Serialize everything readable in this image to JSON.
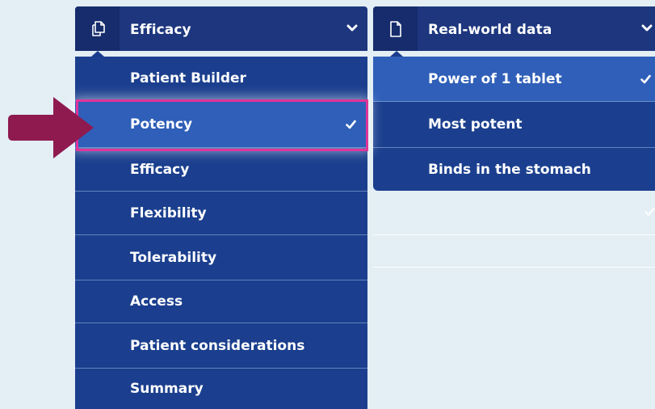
{
  "left_menu": {
    "header_label": "Efficacy",
    "icon": "copy-pages-icon",
    "items": [
      {
        "label": "Patient Builder",
        "selected": false
      },
      {
        "label": "Potency",
        "selected": true
      },
      {
        "label": "Efficacy",
        "selected": false
      },
      {
        "label": "Flexibility",
        "selected": false
      },
      {
        "label": "Tolerability",
        "selected": false
      },
      {
        "label": "Access",
        "selected": false
      },
      {
        "label": "Patient considerations",
        "selected": false
      },
      {
        "label": "Summary",
        "selected": false
      }
    ]
  },
  "right_menu": {
    "header_label": "Real-world data",
    "icon": "document-icon",
    "items": [
      {
        "label": "Power of 1 tablet",
        "selected": true
      },
      {
        "label": "Most potent",
        "selected": false
      },
      {
        "label": "Binds in the stomach",
        "selected": false
      }
    ]
  },
  "annotation": {
    "arrow_color": "#8f1a4f",
    "highlight_color": "#e0359a"
  },
  "colors": {
    "header_bg": "#1d367e",
    "item_bg": "#1b3f8e",
    "selected_bg": "#2f5fb8",
    "page_bg": "#e3eef5"
  }
}
